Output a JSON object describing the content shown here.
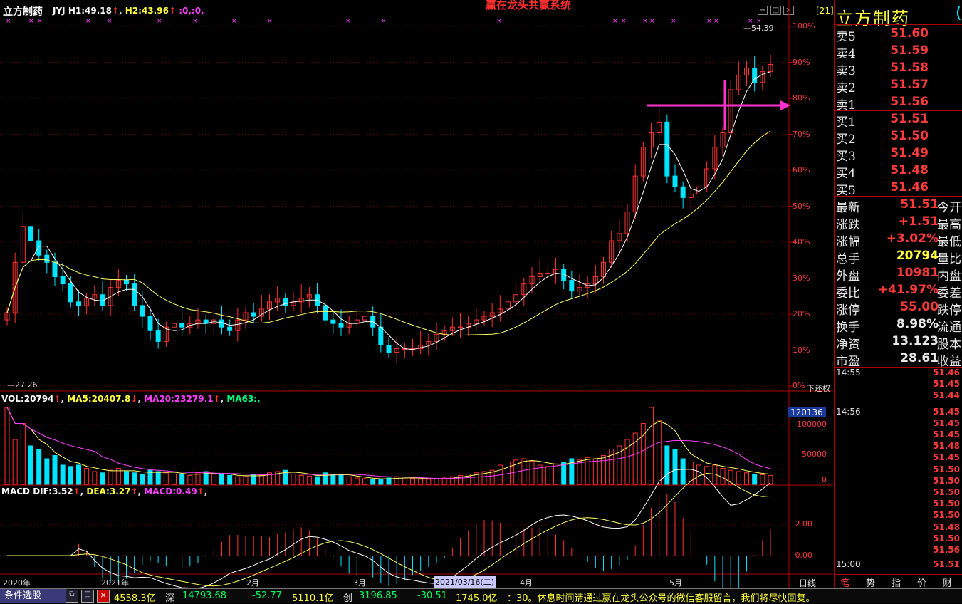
{
  "stock_name": "立方制药",
  "watermark_title": "赢在龙头共赢系统",
  "indicator_header": {
    "name": "JYJ",
    "h1": "H1:49.18",
    "h2": "H2:43.96",
    "extra": ":0,:0,"
  },
  "window_buttons": [
    "−",
    "□",
    "×"
  ],
  "period_badge": "[21]",
  "price_axis": [
    "100%",
    "90%",
    "80%",
    "70%",
    "60%",
    "50%",
    "40%",
    "30%",
    "20%",
    "10%",
    "0%"
  ],
  "hi_label": "54.39",
  "lo_label": "27.26",
  "adj_label": "下还权",
  "vol_header": {
    "vol": "VOL:20794",
    "ma5": "MA5:20407.8",
    "ma20": "MA20:23279.1",
    "ma63": "MA63:,"
  },
  "vol_badge": "120136",
  "vol_axis": [
    "100000",
    "50000",
    "0"
  ],
  "macd_header": {
    "name": "MACD",
    "dif": "DIF:3.52",
    "dea": "DEA:3.27",
    "macd": "MACD:0.49",
    "tail": ","
  },
  "macd_axis": [
    "2.00",
    "0.00"
  ],
  "x_labels": [
    "2020年",
    "2021年",
    "2月",
    "3月",
    "2021/03/16(二)",
    "4月",
    "5月"
  ],
  "timeline_right": "日线",
  "colors": {
    "up": "#ff3232",
    "down": "#00e5ff",
    "ma5": "#ffffff",
    "ma20": "#ffff64",
    "ma_pink": "#ff40ff",
    "grid": "#6a0000",
    "arrow": "#ff33cc"
  },
  "quote": {
    "title": "立方制药",
    "sells": [
      {
        "label": "卖5",
        "price": "51.60"
      },
      {
        "label": "卖4",
        "price": "51.59"
      },
      {
        "label": "卖3",
        "price": "51.58"
      },
      {
        "label": "卖2",
        "price": "51.57"
      },
      {
        "label": "卖1",
        "price": "51.56"
      }
    ],
    "buys": [
      {
        "label": "买1",
        "price": "51.51"
      },
      {
        "label": "买2",
        "price": "51.50"
      },
      {
        "label": "买3",
        "price": "51.49"
      },
      {
        "label": "买4",
        "price": "51.48"
      },
      {
        "label": "买5",
        "price": "51.46"
      }
    ],
    "info": [
      {
        "label": "最新",
        "value": "51.51",
        "label2": "今开",
        "color": "#ff3b3b"
      },
      {
        "label": "涨跌",
        "value": "+1.51",
        "label2": "最高",
        "color": "#ff3b3b"
      },
      {
        "label": "涨幅",
        "value": "+3.02%",
        "label2": "最低",
        "color": "#ff3b3b"
      },
      {
        "label": "总手",
        "value": "20794",
        "label2": "量比",
        "color": "#ffff40"
      },
      {
        "label": "外盘",
        "value": "10981",
        "label2": "内盘",
        "color": "#ff3b3b"
      },
      {
        "label": "委比",
        "value": "+41.97%",
        "label2": "委差",
        "color": "#ff3b3b"
      },
      {
        "label": "涨停",
        "value": "55.00",
        "label2": "跌停",
        "color": "#ff3b3b"
      },
      {
        "label": "换手",
        "value": "8.98%",
        "label2": "流通",
        "color": "#e8e8e8"
      },
      {
        "label": "净资",
        "value": "13.123",
        "label2": "股本",
        "color": "#e8e8e8"
      },
      {
        "label": "市盈",
        "value": "28.61",
        "label2": "收益",
        "color": "#e8e8e8"
      }
    ],
    "ticks": [
      {
        "time": "14:55",
        "price": "51.46"
      },
      {
        "time": "",
        "price": "51.45"
      },
      {
        "time": "",
        "price": "51.44"
      },
      {
        "time": "14:56",
        "price": "51.45"
      },
      {
        "time": "",
        "price": "51.45"
      },
      {
        "time": "",
        "price": "51.45"
      },
      {
        "time": "",
        "price": "51.48"
      },
      {
        "time": "",
        "price": "51.45"
      },
      {
        "time": "",
        "price": "51.50"
      },
      {
        "time": "",
        "price": "51.50"
      },
      {
        "time": "",
        "price": "51.50"
      },
      {
        "time": "",
        "price": "51.50"
      },
      {
        "time": "",
        "price": "51.50"
      },
      {
        "time": "",
        "price": "51.48"
      },
      {
        "time": "",
        "price": "51.50"
      },
      {
        "time": "",
        "price": "51.56"
      },
      {
        "time": "15:00",
        "price": "51.51"
      }
    ],
    "tabs": [
      "笔",
      "势",
      "指",
      "价",
      "财"
    ]
  },
  "bottom_bar": {
    "filter_label": "条件选股",
    "sh_value": "4558.3亿",
    "sz_label": "深",
    "sz_index": "14793.68",
    "sz_change": "-52.77",
    "sz_amount": "5110.1亿",
    "cy_label": "创",
    "cy_index": "3196.85",
    "cy_change": "-30.51",
    "cy_amount": "1745.0亿",
    "notice": "：30。休息时间请通过赢在龙头公众号的微信客服留言，我们将尽快回复。"
  },
  "chart_data": {
    "type": "candlestick",
    "y_axis_unit": "percent of visible range",
    "high_mark": 54.39,
    "low_mark": 27.26,
    "note_indicators": [
      "MA5",
      "MA20",
      "VOL",
      "MACD"
    ]
  }
}
